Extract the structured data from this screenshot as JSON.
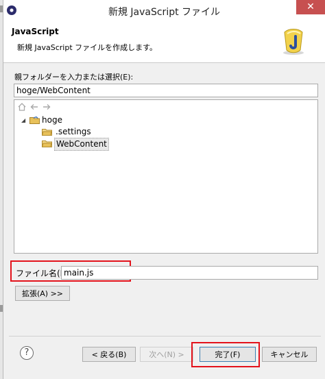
{
  "window": {
    "title": "新規 JavaScript ファイル",
    "close_glyph": "✕"
  },
  "header": {
    "title": "JavaScript",
    "description": "新規 JavaScript ファイルを作成します。",
    "icon": "javascript-wizard-icon"
  },
  "parent_folder": {
    "label": "親フォルダーを入力または選択(E):",
    "value": "hoge/WebContent"
  },
  "tree": {
    "toolbar_icons": [
      "home-icon",
      "back-arrow-icon",
      "forward-arrow-icon"
    ],
    "project": {
      "label": "hoge",
      "expanded": true,
      "twisty": "◢"
    },
    "children": [
      {
        "label": ".settings",
        "selected": false
      },
      {
        "label": "WebContent",
        "selected": true
      }
    ]
  },
  "file_name": {
    "label": "ファイル名(M):",
    "value": "main.js"
  },
  "buttons": {
    "advanced": "拡張(A) >>",
    "back": "< 戻る(B)",
    "next": "次へ(N) >",
    "finish": "完了(F)",
    "cancel": "キャンセル"
  },
  "help": {
    "glyph": "?"
  },
  "colors": {
    "highlight_red": "#e3121b",
    "folder_yellow": "#e8c15a",
    "title_close": "#c75050"
  }
}
